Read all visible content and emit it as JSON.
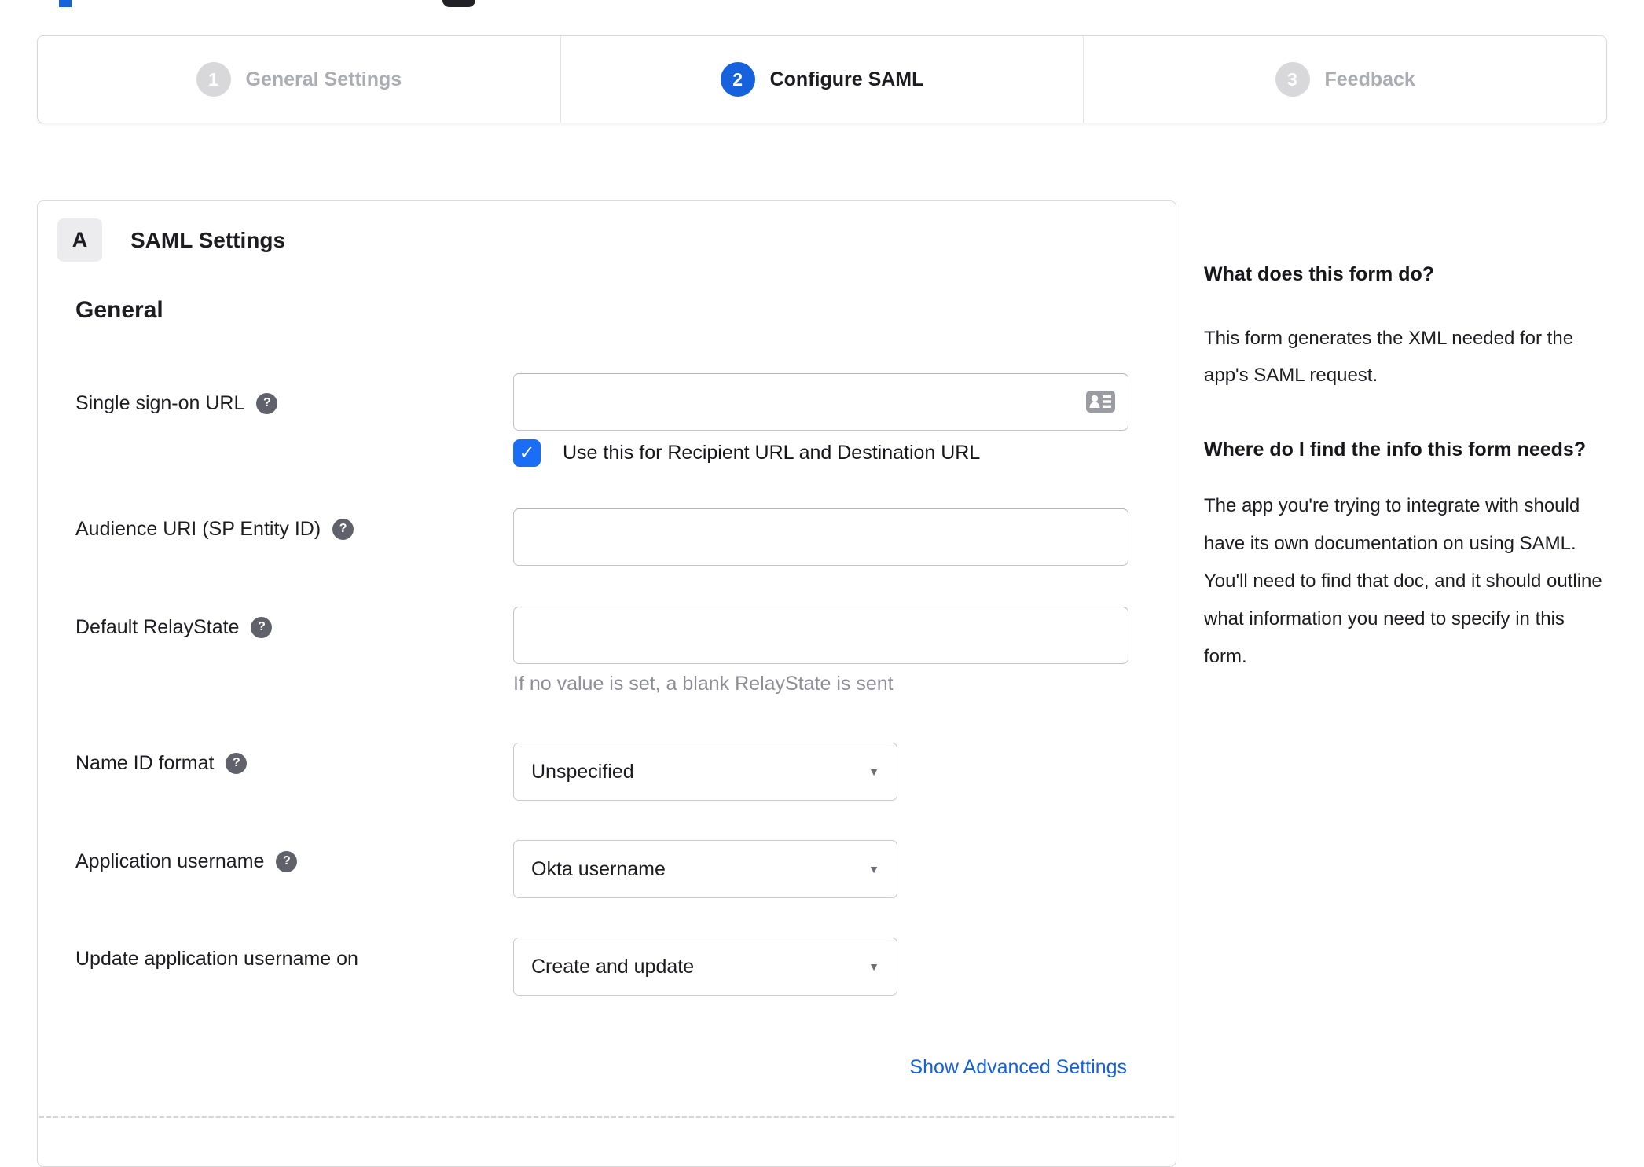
{
  "stepper": {
    "steps": [
      {
        "number": "1",
        "label": "General Settings",
        "state": "inactive"
      },
      {
        "number": "2",
        "label": "Configure SAML",
        "state": "active"
      },
      {
        "number": "3",
        "label": "Feedback",
        "state": "inactive"
      }
    ]
  },
  "panel": {
    "badge": "A",
    "title": "SAML Settings",
    "section_heading": "General",
    "fields": {
      "sso": {
        "label": "Single sign-on URL",
        "value": "",
        "checkbox_label": "Use this for Recipient URL and Destination URL",
        "checkbox_checked": true
      },
      "audience": {
        "label": "Audience URI (SP Entity ID)",
        "value": ""
      },
      "relay": {
        "label": "Default RelayState",
        "value": "",
        "hint": "If no value is set, a blank RelayState is sent"
      },
      "name_id": {
        "label": "Name ID format",
        "value": "Unspecified"
      },
      "app_username": {
        "label": "Application username",
        "value": "Okta username"
      },
      "update_username": {
        "label": "Update application username on",
        "value": "Create and update"
      }
    },
    "advanced_link": "Show Advanced Settings"
  },
  "sidebar": {
    "q1": "What does this form do?",
    "a1": "This form generates the XML needed for the app's SAML request.",
    "q2": "Where do I find the info this form needs?",
    "a2": "The app you're trying to integrate with should have its own documentation on using SAML. You'll need to find that doc, and it should outline what information you need to specify in this form."
  },
  "icons": {
    "question": "?",
    "check": "✓",
    "caret": "▼"
  },
  "colors": {
    "okta_blue": "#1662dd",
    "checkbox_blue": "#1a6ef5",
    "link_blue": "#1660da"
  }
}
